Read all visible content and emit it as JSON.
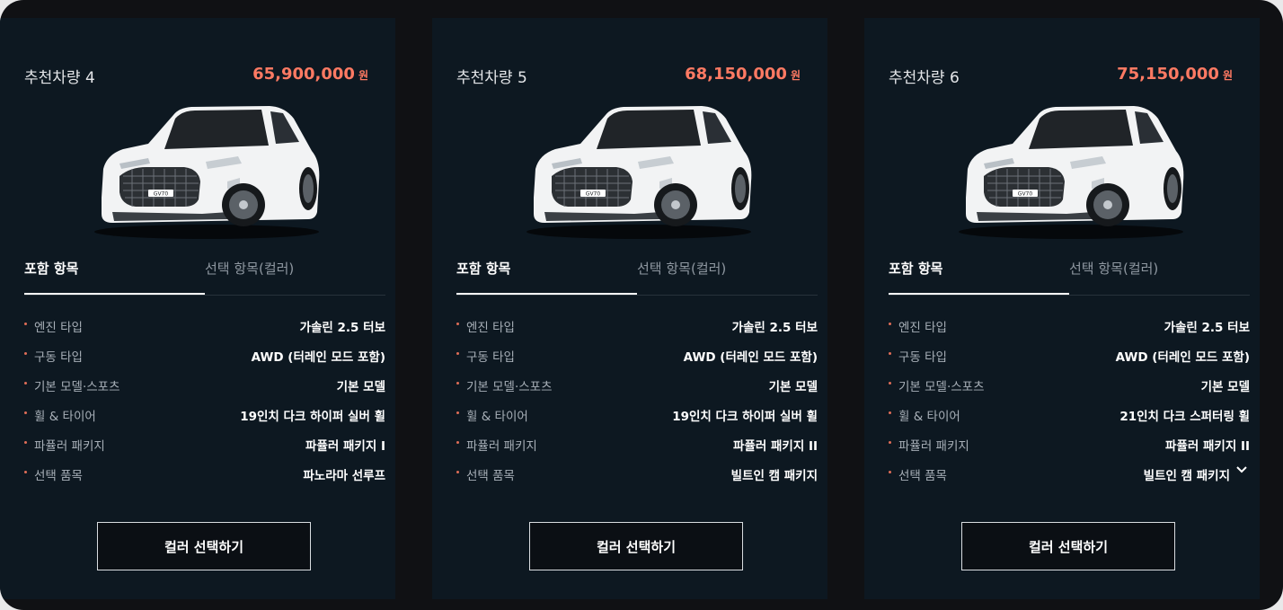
{
  "cards": [
    {
      "title": "추천차량 4",
      "price": "65,900,000",
      "unit": "원",
      "tabs": {
        "included": "포함 항목",
        "options": "선택 항목(컬러)"
      },
      "specs": [
        {
          "label": "엔진 타입",
          "value": "가솔린 2.5 터보"
        },
        {
          "label": "구동 타입",
          "value": "AWD (터레인 모드 포함)"
        },
        {
          "label": "기본 모델·스포츠",
          "value": "기본 모델"
        },
        {
          "label": "휠 & 타이어",
          "value": "19인치 다크 하이퍼 실버 휠"
        },
        {
          "label": "파퓰러 패키지",
          "value": "파퓰러 패키지 I"
        },
        {
          "label": "선택 품목",
          "value": "파노라마 선루프"
        }
      ],
      "button": "컬러 선택하기",
      "badge": "GV70"
    },
    {
      "title": "추천차량 5",
      "price": "68,150,000",
      "unit": "원",
      "tabs": {
        "included": "포함 항목",
        "options": "선택 항목(컬러)"
      },
      "specs": [
        {
          "label": "엔진 타입",
          "value": "가솔린 2.5 터보"
        },
        {
          "label": "구동 타입",
          "value": "AWD (터레인 모드 포함)"
        },
        {
          "label": "기본 모델·스포츠",
          "value": "기본 모델"
        },
        {
          "label": "휠 & 타이어",
          "value": "19인치 다크 하이퍼 실버 휠"
        },
        {
          "label": "파퓰러 패키지",
          "value": "파퓰러 패키지 II"
        },
        {
          "label": "선택 품목",
          "value": "빌트인 캠 패키지"
        }
      ],
      "button": "컬러 선택하기",
      "badge": "GV70"
    },
    {
      "title": "추천차량 6",
      "price": "75,150,000",
      "unit": "원",
      "tabs": {
        "included": "포함 항목",
        "options": "선택 항목(컬러)"
      },
      "specs": [
        {
          "label": "엔진 타입",
          "value": "가솔린 2.5 터보"
        },
        {
          "label": "구동 타입",
          "value": "AWD (터레인 모드 포함)"
        },
        {
          "label": "기본 모델·스포츠",
          "value": "기본 모델"
        },
        {
          "label": "휠 & 타이어",
          "value": "21인치 다크 스퍼터링 휠"
        },
        {
          "label": "파퓰러 패키지",
          "value": "파퓰러 패키지 II"
        },
        {
          "label": "선택 품목",
          "value": "빌트인 캠 패키지"
        }
      ],
      "button": "컬러 선택하기",
      "badge": "GV70"
    }
  ],
  "expand_icon": "chevron-down-icon",
  "colors": {
    "price": "#ff7a63",
    "card_bg": "#0d1821",
    "page_bg": "#101114"
  }
}
